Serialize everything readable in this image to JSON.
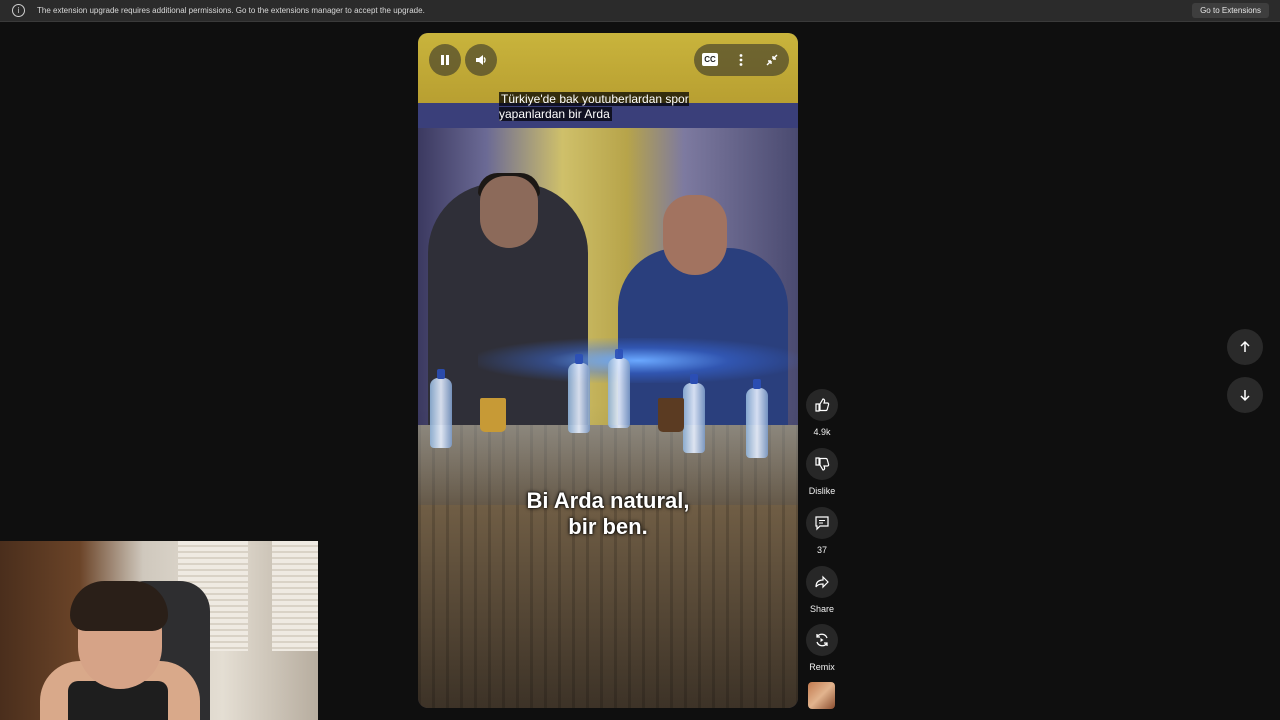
{
  "infobar": {
    "message": "The extension upgrade requires additional permissions. Go to the extensions manager to accept the upgrade.",
    "button_label": "Go to Extensions",
    "icon": "info-icon"
  },
  "player": {
    "caption_top": "Türkiye'de bak youtuberlardan spor yapanlardan bir Arda",
    "caption_bottom_line1": "Bi Arda natural,",
    "caption_bottom_line2": "bir ben.",
    "controls": {
      "play_state_icon": "pause-icon",
      "volume_icon": "volume-icon",
      "cc_label": "CC",
      "more_icon": "more-vert-icon",
      "exit_fullscreen_icon": "exit-fullscreen-icon"
    }
  },
  "actions": {
    "like_count": "4.9k",
    "dislike_label": "Dislike",
    "comment_count": "37",
    "share_label": "Share",
    "remix_label": "Remix"
  },
  "navigation": {
    "up_icon": "arrow-up-icon",
    "down_icon": "arrow-down-icon"
  },
  "colors": {
    "page_bg": "#0f0f0f",
    "infobar_bg": "#2b2b2b",
    "action_btn_bg": "#272727"
  }
}
